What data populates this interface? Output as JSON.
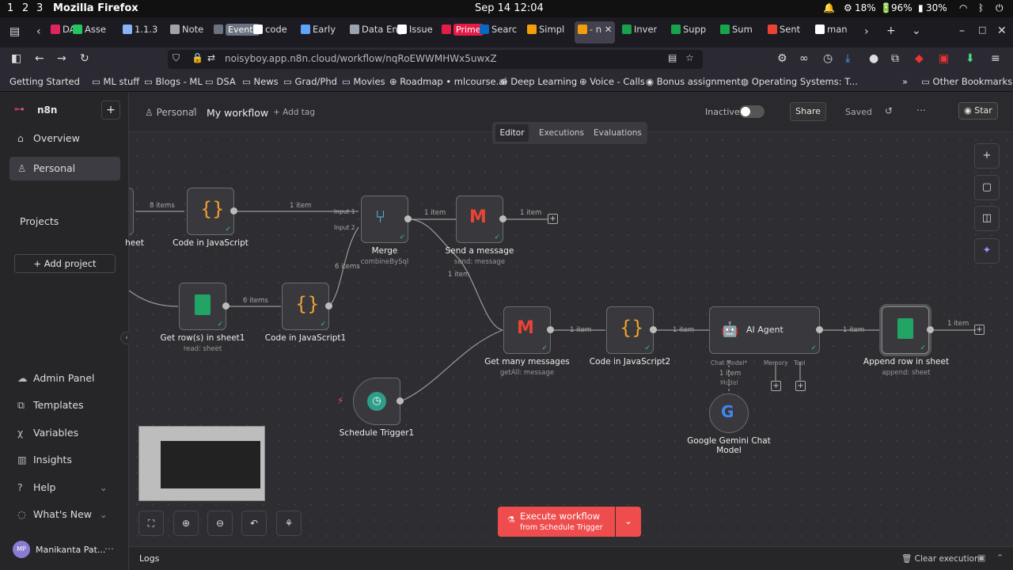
{
  "system": {
    "workspaces": [
      "1",
      "2",
      "3"
    ],
    "app_name": "Mozilla Firefox",
    "clock": "Sep 14 12:04",
    "cpu": "18%",
    "battery": "96%",
    "battery2": "30%"
  },
  "browser": {
    "tabs": [
      {
        "label": "DA",
        "color": "#e0245e"
      },
      {
        "label": "Asse",
        "color": "#22c55e"
      },
      {
        "label": "1.1.3",
        "color": "#8ab4f8"
      },
      {
        "label": "Note",
        "color": "#a3a3a3"
      },
      {
        "label": "Events",
        "color": "#6b7280",
        "badge": true
      },
      {
        "label": "code",
        "color": "#ffffff"
      },
      {
        "label": "Early",
        "color": "#60a5fa"
      },
      {
        "label": "Data Eng",
        "color": "#9ca3af"
      },
      {
        "label": "Issue",
        "color": "#ffffff"
      },
      {
        "label": "Prime",
        "color": "#e11d48",
        "badge": true
      },
      {
        "label": "Searc",
        "color": "#0a66c2"
      },
      {
        "label": "Simpl",
        "color": "#f59e0b"
      },
      {
        "label": "- n",
        "color": "#f59e0b",
        "active": true
      },
      {
        "label": "Inver",
        "color": "#16a34a"
      },
      {
        "label": "Supp",
        "color": "#16a34a"
      },
      {
        "label": "Sum",
        "color": "#16a34a"
      },
      {
        "label": "Sent",
        "color": "#ea4335"
      },
      {
        "label": "man",
        "color": "#ffffff"
      }
    ],
    "url": "noisyboy.app.n8n.cloud/workflow/nqRoEWWMHWx5uwxZ",
    "bookmarks": [
      "Getting Started",
      "ML stuff",
      "Blogs - ML",
      "DSA",
      "News",
      "Grad/Phd",
      "Movies",
      "Roadmap • mlcourse.ai",
      "Deep Learning",
      "Voice - Calls",
      "Bonus assignment",
      "Operating Systems: T...",
      "Other Bookmarks"
    ]
  },
  "sidebar": {
    "brand": "n8n",
    "items": [
      "Overview",
      "Personal"
    ],
    "projects_label": "Projects",
    "add_project": "Add project",
    "bottom": [
      "Admin Panel",
      "Templates",
      "Variables",
      "Insights",
      "Help",
      "What's New"
    ],
    "user": "Manikanta Pat..."
  },
  "header": {
    "breadcrumb_project": "Personal",
    "workflow_name": "My workflow",
    "add_tag": "+ Add tag",
    "status": "Inactive",
    "share": "Share",
    "saved": "Saved",
    "star": "Star",
    "tabs": [
      "Editor",
      "Executions",
      "Evaluations"
    ]
  },
  "canvas": {
    "nodes": [
      {
        "id": "sheet",
        "label": "heet",
        "sub": ""
      },
      {
        "id": "code1",
        "label": "Code in JavaScript",
        "sub": ""
      },
      {
        "id": "merge",
        "label": "Merge",
        "sub": "combineBySql"
      },
      {
        "id": "send",
        "label": "Send a message",
        "sub": "send: message"
      },
      {
        "id": "getrows",
        "label": "Get row(s) in sheet1",
        "sub": "read: sheet"
      },
      {
        "id": "code2",
        "label": "Code in JavaScript1",
        "sub": ""
      },
      {
        "id": "getmsg",
        "label": "Get many messages",
        "sub": "getAll: message"
      },
      {
        "id": "code3",
        "label": "Code in JavaScript2",
        "sub": ""
      },
      {
        "id": "agent",
        "label": "AI Agent",
        "sub": ""
      },
      {
        "id": "append",
        "label": "Append row in sheet",
        "sub": "append: sheet"
      },
      {
        "id": "trigger",
        "label": "Schedule Trigger1",
        "sub": ""
      },
      {
        "id": "gemini",
        "label": "Google Gemini Chat Model",
        "sub": ""
      }
    ],
    "edges": [
      "8 items",
      "1 item",
      "1 item",
      "1 item",
      "6 items",
      "6 items",
      "1 item",
      "1 item",
      "1 item",
      "1 item",
      "1 item",
      "1 item"
    ],
    "merge_inputs": [
      "Input 1",
      "Input 2"
    ],
    "agent_ports": [
      "Chat Model*",
      "Memory",
      "Tool"
    ],
    "gemini_edge": "1 item",
    "gemini_edge_sub": "Model"
  },
  "footer": {
    "execute": "Execute workflow",
    "execute_sub": "from Schedule Trigger",
    "logs": "Logs",
    "clear": "Clear execution"
  }
}
